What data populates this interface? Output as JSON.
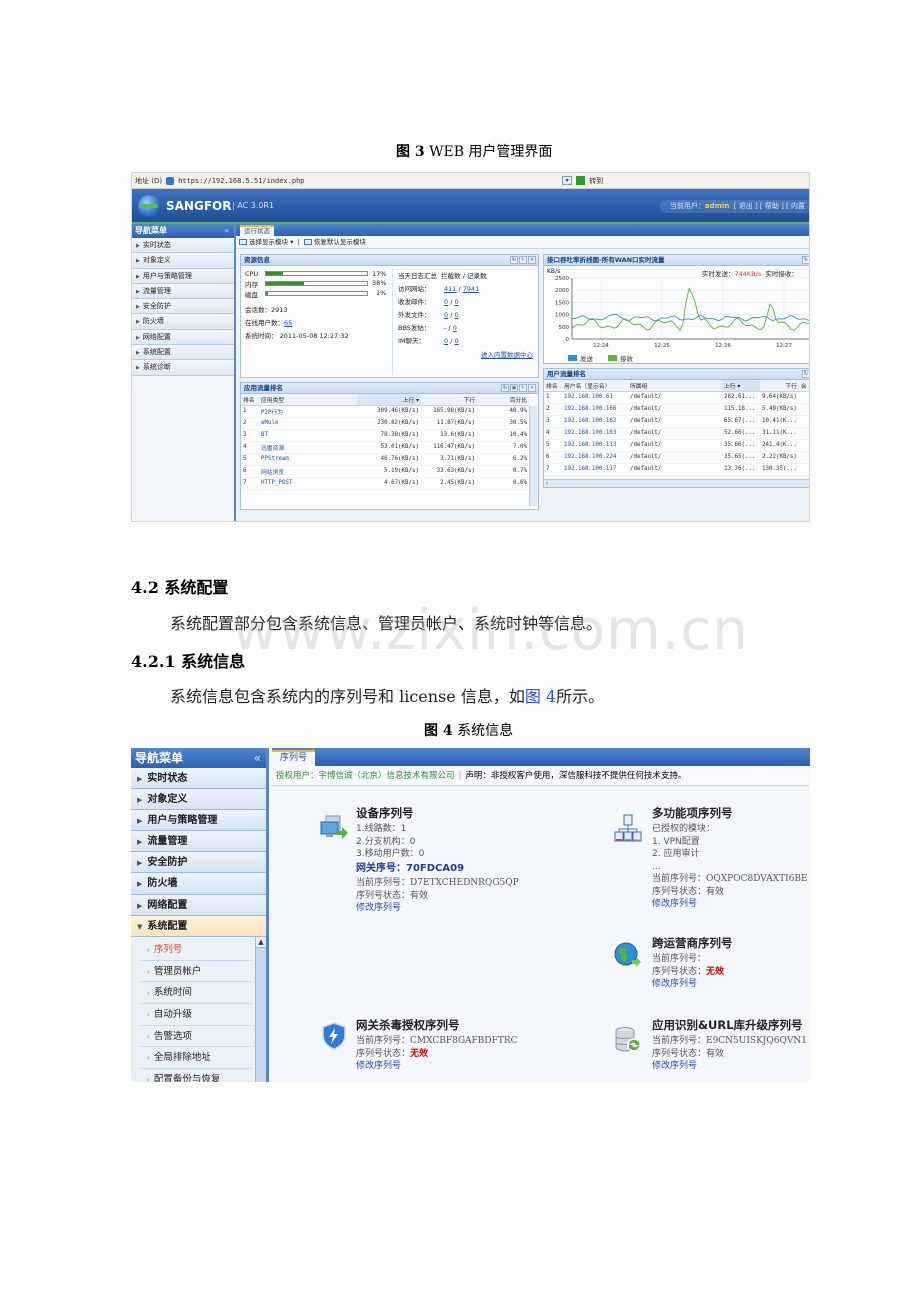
{
  "fig3": {
    "caption_num": "图 3",
    "caption_text": "WEB 用户管理界面",
    "browser": {
      "address_label": "地址 (D)",
      "url": "https://192.168.5.51/index.php",
      "go_label": "转到"
    },
    "header": {
      "brand": "SANGFOR",
      "version": "| AC 3.0R1",
      "current_user_label": "当前用户：",
      "current_user": "admin",
      "links": "[ 退出 ] [ 帮助 ] [ 内置"
    },
    "nav": {
      "title": "导航菜单",
      "collapse": "«",
      "items": [
        "实时状态",
        "对象定义",
        "用户与策略管理",
        "流量管理",
        "安全防护",
        "防火墙",
        "网络配置",
        "系统配置",
        "系统诊断"
      ]
    },
    "tab": "运行状态",
    "toolbar": {
      "select_modules": "选择显示模块 ▾",
      "restore_default": "恢复默认显示模块"
    },
    "resources": {
      "title": "资源信息",
      "cpu_label": "CPU",
      "cpu_pct": "17%",
      "cpu_value": 0.17,
      "mem_label": "内存",
      "mem_pct": "38%",
      "mem_value": 0.38,
      "disk_label": "磁盘",
      "disk_pct": "1%",
      "disk_value": 0.01,
      "sessions": "会话数：2913",
      "online_label": "在线用户数：",
      "online_value": "65",
      "system_time": "系统时间： 2011-05-08 12:27:32",
      "log_header": "当天日志汇总",
      "log_header2": "拦截数 / 记录数",
      "logs": [
        {
          "label": "访问网站：",
          "a": "411",
          "b": "7941"
        },
        {
          "label": "收发邮件：",
          "a": "0",
          "b": "0"
        },
        {
          "label": "外发文件：",
          "a": "0",
          "b": "0"
        },
        {
          "label": "BBS发帖：",
          "a": "-",
          "b": "0"
        },
        {
          "label": "IM聊天：",
          "a": "0",
          "b": "0"
        }
      ],
      "datacenter_link": "进入内置数据中心"
    },
    "throughput": {
      "title": "接口吞吐率折线图-所有WAN口实时流量",
      "unit": "KB/s",
      "send_label": "实时发送：",
      "send_value": "744KB/s",
      "recv_label": "实时接收：",
      "yticks": [
        "2500",
        "2000",
        "1500",
        "1000",
        "500",
        "0"
      ],
      "xticks": [
        "12:24",
        "12:25",
        "12:26",
        "12:27"
      ],
      "legend": [
        {
          "name": "发送",
          "color": "#2f8fd0"
        },
        {
          "name": "接收",
          "color": "#5cb83c"
        }
      ]
    },
    "app_rank": {
      "title": "应用流量排名",
      "columns": [
        "排名",
        "应用类型",
        "上行 ▾",
        "下行",
        "百分比"
      ],
      "rows": [
        [
          "1",
          "P2P行为",
          "309.46(KB/s)",
          "165.98(KB/s)",
          "40.9%"
        ],
        [
          "2",
          "eMule",
          "230.82(KB/s)",
          "11.87(KB/s)",
          "30.5%"
        ],
        [
          "3",
          "BT",
          "78.38(KB/s)",
          "13.6(KB/s)",
          "10.4%"
        ],
        [
          "4",
          "迅雷资源",
          "53.01(KB/s)",
          "116.47(KB/s)",
          "7.0%"
        ],
        [
          "5",
          "PPStream",
          "46.76(KB/s)",
          "3.71(KB/s)",
          "6.2%"
        ],
        [
          "6",
          "网站浏览",
          "5.19(KB/s)",
          "33.63(KB/s)",
          "0.7%"
        ],
        [
          "7",
          "HTTP_POST",
          "4.67(KB/s)",
          "2.45(KB/s)",
          "0.6%"
        ]
      ]
    },
    "user_rank": {
      "title": "用户流量排名",
      "columns": [
        "排名",
        "用户名（显示名）",
        "所属组",
        "上行 ▾",
        "下行",
        "会"
      ],
      "rows": [
        [
          "1",
          "192.168.100.61",
          "/default/",
          "282.61...",
          "9.64(KB/s)"
        ],
        [
          "2",
          "192.168.100.166",
          "/default/",
          "115.18...",
          "5.49(KB/s)"
        ],
        [
          "3",
          "192.168.100.162",
          "/default/",
          "65.67(...",
          "10.41(K..."
        ],
        [
          "4",
          "192.168.100.103",
          "/default/",
          "52.66(...",
          "31.11(K..."
        ],
        [
          "5",
          "192.168.100.113",
          "/default/",
          "35.66(...",
          "241.4(K..."
        ],
        [
          "6",
          "192.168.100.224",
          "/default/",
          "35.65(...",
          "2.22(KB/s)"
        ],
        [
          "7",
          "192.168.100.117",
          "/default/",
          "13.76(...",
          "130.35(..."
        ]
      ]
    }
  },
  "doc": {
    "h_42": "4.2 系统配置",
    "p_42": "系统配置部分包含系统信息、管理员帐户、系统时钟等信息。",
    "h_421": "4.2.1 系统信息",
    "p_421_a": "系统信息包含系统内的序列号和 license 信息，如",
    "p_421_ref": "图 4",
    "p_421_b": "所示。",
    "watermark": "www.zixin.com.cn"
  },
  "fig4": {
    "caption_num": "图 4",
    "caption_text": "系统信息",
    "nav": {
      "title": "导航菜单",
      "collapse": "«",
      "items": [
        "实时状态",
        "对象定义",
        "用户与策略管理",
        "流量管理",
        "安全防护",
        "防火墙",
        "网络配置"
      ],
      "open_item": "系统配置",
      "sub_items": [
        "序列号",
        "管理员帐户",
        "系统时间",
        "自动升级",
        "告警选项",
        "全局排除地址",
        "配置备份与恢复"
      ]
    },
    "tab": "序列号",
    "notice": {
      "licensed": "授权用户：宇博信诚（北京）信息技术有限公司",
      "statement": "声明：非授权客户使用，深信服科技不提供任何技术支持。"
    },
    "device": {
      "title": "设备序列号",
      "lines": [
        "1.线路数：1",
        "2.分支机构：0",
        "3.移动用户数：0"
      ],
      "gateway": "网关序号：70FDCA09",
      "current": "当前序列号：D7ETXCHEDNRQG5QP",
      "status_label": "序列号状态：",
      "status": "有效",
      "edit": "修改序列号"
    },
    "multi": {
      "title": "多功能项序列号",
      "lines": [
        "已授权的模块：",
        "1. VPN配置",
        "2. 应用审计",
        "..."
      ],
      "current": "当前序列号：OQXPOC8DVAXTI6BE",
      "status_label": "序列号状态：",
      "status": "有效",
      "edit": "修改序列号"
    },
    "isp": {
      "title": "跨运营商序列号",
      "current": "当前序列号：",
      "status_label": "序列号状态：",
      "status": "无效",
      "edit": "修改序列号"
    },
    "av": {
      "title": "网关杀毒授权序列号",
      "current": "当前序列号：CMXCBF8GAFBDFTRC",
      "status_label": "序列号状态：",
      "status": "无效",
      "edit": "修改序列号"
    },
    "appurl": {
      "title": "应用识别&URL库升级序列号",
      "current": "当前序列号：E9CN5UISKJQ6QVN1",
      "status_label": "序列号状态：",
      "status": "有效",
      "edit": "修改序列号"
    }
  }
}
